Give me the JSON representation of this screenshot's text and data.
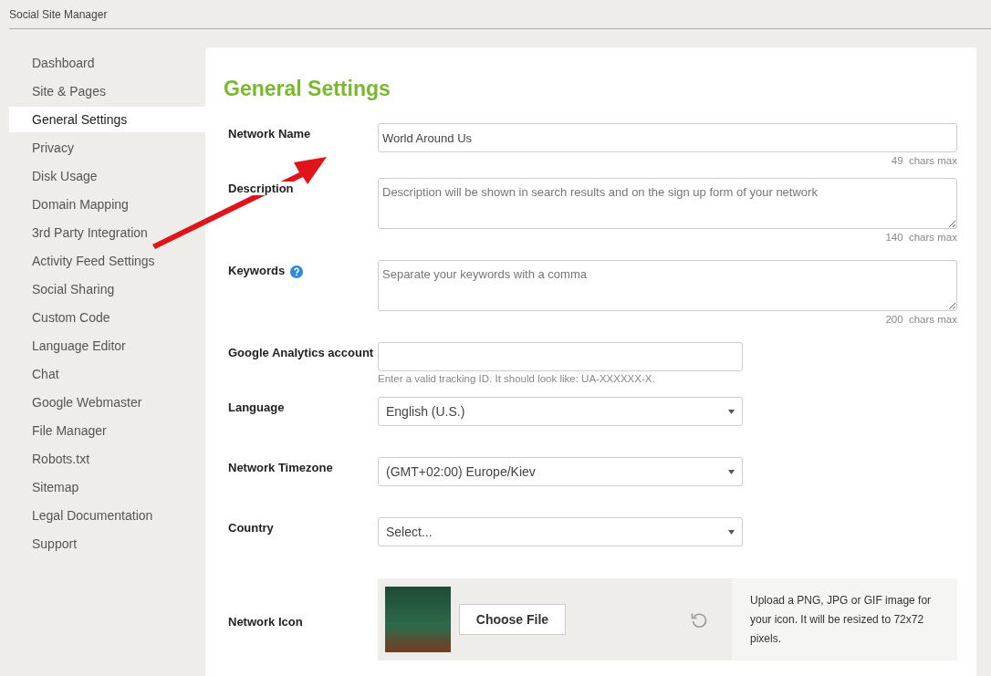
{
  "window": {
    "title": "Social Site Manager"
  },
  "sidebar": {
    "items": [
      {
        "label": "Dashboard",
        "selected": false
      },
      {
        "label": "Site & Pages",
        "selected": false
      },
      {
        "label": "General Settings",
        "selected": true
      },
      {
        "label": "Privacy",
        "selected": false
      },
      {
        "label": "Disk Usage",
        "selected": false
      },
      {
        "label": "Domain Mapping",
        "selected": false
      },
      {
        "label": "3rd Party Integration",
        "selected": false
      },
      {
        "label": "Activity Feed Settings",
        "selected": false
      },
      {
        "label": "Social Sharing",
        "selected": false
      },
      {
        "label": "Custom Code",
        "selected": false
      },
      {
        "label": "Language Editor",
        "selected": false
      },
      {
        "label": "Chat",
        "selected": false
      },
      {
        "label": "Google Webmaster",
        "selected": false
      },
      {
        "label": "File Manager",
        "selected": false
      },
      {
        "label": "Robots.txt",
        "selected": false
      },
      {
        "label": "Sitemap",
        "selected": false
      },
      {
        "label": "Legal Documentation",
        "selected": false
      },
      {
        "label": "Support",
        "selected": false
      }
    ]
  },
  "page": {
    "title": "General Settings",
    "fields": [
      {
        "kind": "text",
        "label": "Network Name",
        "value": "World Around Us",
        "limit": "49",
        "limit_suffix": "chars max"
      },
      {
        "kind": "textarea",
        "label": "Description",
        "placeholder": "Description will be shown in search results and on the sign up form of your network",
        "limit": "140",
        "limit_suffix": "chars max"
      },
      {
        "kind": "textarea",
        "label": "Keywords",
        "help": true,
        "placeholder": "Separate your keywords with a comma",
        "limit": "200",
        "limit_suffix": "chars max"
      },
      {
        "kind": "short",
        "label": "Google Analytics account",
        "hint": "Enter a valid tracking ID. It should look like: UA-XXXXXX-X."
      },
      {
        "kind": "select",
        "label": "Language",
        "value": "English (U.S.)"
      },
      {
        "kind": "select",
        "label": "Network Timezone",
        "value": "(GMT+02:00) Europe/Kiev"
      },
      {
        "kind": "select",
        "label": "Country",
        "value": "Select..."
      },
      {
        "kind": "upload",
        "label": "Network Icon",
        "button": "Choose File",
        "note": "Upload a PNG, JPG or GIF image for your icon. It will be resized to 72x72 pixels."
      }
    ]
  }
}
